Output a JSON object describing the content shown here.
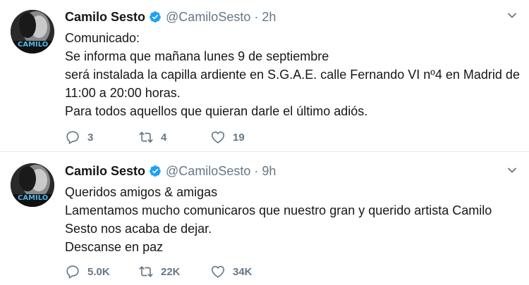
{
  "tweets": [
    {
      "author_name": "Camilo Sesto",
      "handle": "@CamiloSesto",
      "separator": "·",
      "time": "2h",
      "avatar_text": "CAMILO",
      "lines": [
        "Comunicado:",
        "Se informa que mañana lunes 9 de septiembre",
        "será instalada la capilla ardiente en S.G.A.E. calle Fernando VI nº4 en Madrid  de",
        "11:00 a 20:00 horas.",
        "Para todos aquellos que quieran darle el último adiós."
      ],
      "replies": "3",
      "retweets": "4",
      "likes": "19"
    },
    {
      "author_name": "Camilo Sesto",
      "handle": "@CamiloSesto",
      "separator": "·",
      "time": "9h",
      "avatar_text": "CAMILO",
      "lines": [
        "Queridos amigos & amigas",
        "Lamentamos mucho comunicaros que nuestro gran y querido artista Camilo",
        "Sesto nos acaba de dejar.",
        "Descanse en paz"
      ],
      "replies": "5.0K",
      "retweets": "22K",
      "likes": "34K"
    }
  ],
  "icons": {
    "verified": "verified-badge-icon",
    "caret": "chevron-down-icon",
    "reply": "reply-icon",
    "retweet": "retweet-icon",
    "like": "heart-icon"
  },
  "colors": {
    "verified_blue": "#1da1f2",
    "secondary_text": "#657786",
    "primary_text": "#14171a",
    "divider": "#e6ecf0"
  }
}
